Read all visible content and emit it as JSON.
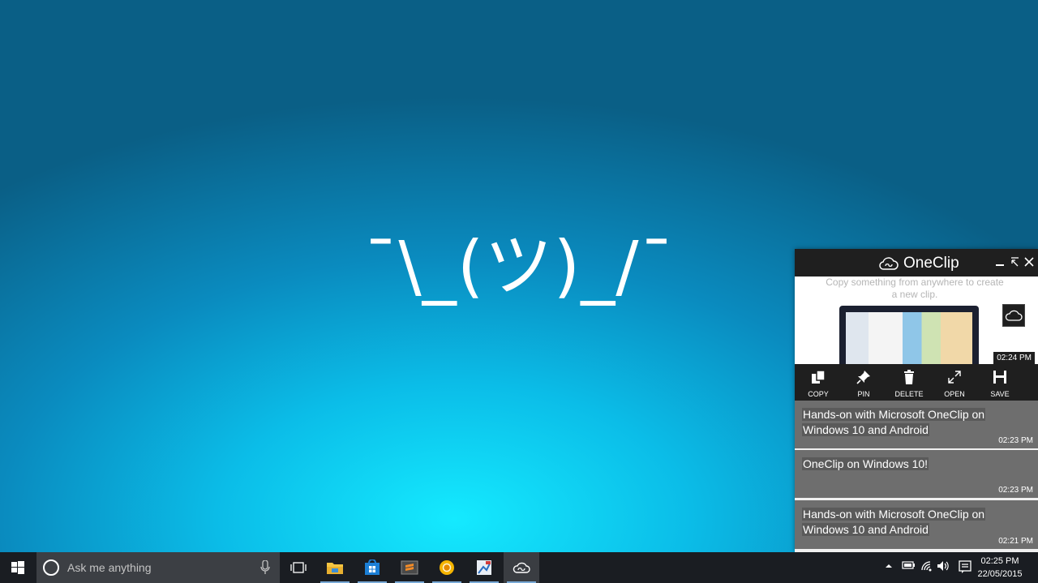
{
  "desktop": {
    "wallpaper_text": "¯\\_(ツ)_/¯"
  },
  "oneclip": {
    "title": "OneClip",
    "controls": [
      "minimize",
      "restore",
      "close"
    ],
    "preview": {
      "text": "Copy something from anywhere to create a new clip.",
      "time": "02:24 PM"
    },
    "actions": [
      {
        "label": "COPY",
        "icon": "copy-icon"
      },
      {
        "label": "PIN",
        "icon": "pin-icon"
      },
      {
        "label": "DELETE",
        "icon": "trash-icon"
      },
      {
        "label": "OPEN",
        "icon": "expand-icon"
      },
      {
        "label": "SAVE",
        "icon": "save-icon"
      }
    ],
    "clips": [
      {
        "text": "Hands-on with Microsoft OneClip on Windows 10 and Android",
        "time": "02:23 PM"
      },
      {
        "text": "OneClip on Windows 10!",
        "time": "02:23 PM"
      },
      {
        "text": "Hands-on with Microsoft OneClip on Windows 10 and Android",
        "time": "02:21 PM"
      }
    ]
  },
  "taskbar": {
    "search_placeholder": "Ask me anything",
    "apps": [
      {
        "name": "task-view",
        "icon": "task-view-icon"
      },
      {
        "name": "file-explorer",
        "icon": "folder-icon"
      },
      {
        "name": "store",
        "icon": "store-icon"
      },
      {
        "name": "sublime-text",
        "icon": "sublime-icon"
      },
      {
        "name": "chrome-canary",
        "icon": "chrome-canary-icon"
      },
      {
        "name": "paint",
        "icon": "paint-icon"
      },
      {
        "name": "oneclip",
        "icon": "oneclip-icon"
      }
    ],
    "tray": {
      "icons": [
        "chevron-up-icon",
        "battery-icon",
        "wifi-icon",
        "volume-icon",
        "action-center-icon"
      ],
      "time": "02:25 PM",
      "date": "22/05/2015"
    }
  },
  "colors": {
    "taskbar": "#1a1d22",
    "oneclip_header": "#1f1f1f",
    "clip_card": "#6e6e6e",
    "accent": "#78a9d6"
  }
}
